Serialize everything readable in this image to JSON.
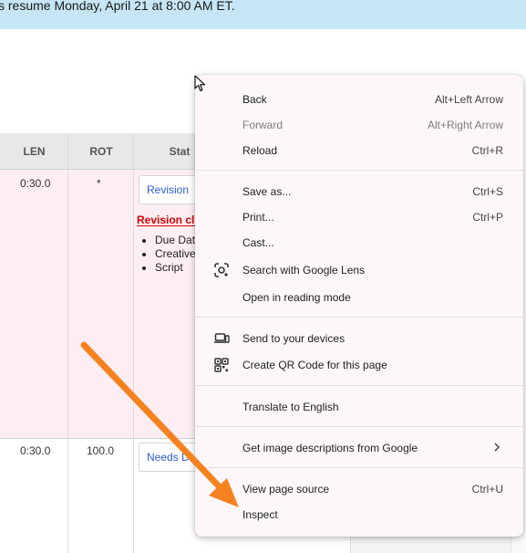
{
  "banner": {
    "text": "s resume Monday, April 21 at 8:00 AM ET."
  },
  "table": {
    "headers": {
      "len": "LEN",
      "rot": "ROT",
      "status": "Stat"
    },
    "rows": [
      {
        "len": "0:30.0",
        "rot": "*",
        "status": "Revision",
        "note": "Revision cl",
        "bullets": [
          "Due Date",
          "Creative",
          "Script"
        ]
      },
      {
        "len": "0:30.0",
        "rot": "100.0",
        "status": "Needs D"
      }
    ]
  },
  "menu": {
    "back": {
      "label": "Back",
      "shortcut": "Alt+Left Arrow"
    },
    "forward": {
      "label": "Forward",
      "shortcut": "Alt+Right Arrow"
    },
    "reload": {
      "label": "Reload",
      "shortcut": "Ctrl+R"
    },
    "save_as": {
      "label": "Save as...",
      "shortcut": "Ctrl+S"
    },
    "print": {
      "label": "Print...",
      "shortcut": "Ctrl+P"
    },
    "cast": {
      "label": "Cast..."
    },
    "lens": {
      "label": "Search with Google Lens"
    },
    "reading_mode": {
      "label": "Open in reading mode"
    },
    "send_devices": {
      "label": "Send to your devices"
    },
    "qr_code": {
      "label": "Create QR Code for this page"
    },
    "translate": {
      "label": "Translate to English"
    },
    "image_desc": {
      "label": "Get image descriptions from Google"
    },
    "view_source": {
      "label": "View page source",
      "shortcut": "Ctrl+U"
    },
    "inspect": {
      "label": "Inspect"
    }
  },
  "colors": {
    "arrow": "#f5821f",
    "banner": "#c6e6f5",
    "menu_bg": "#fdf7fa",
    "row_highlight": "#fdeef3"
  }
}
